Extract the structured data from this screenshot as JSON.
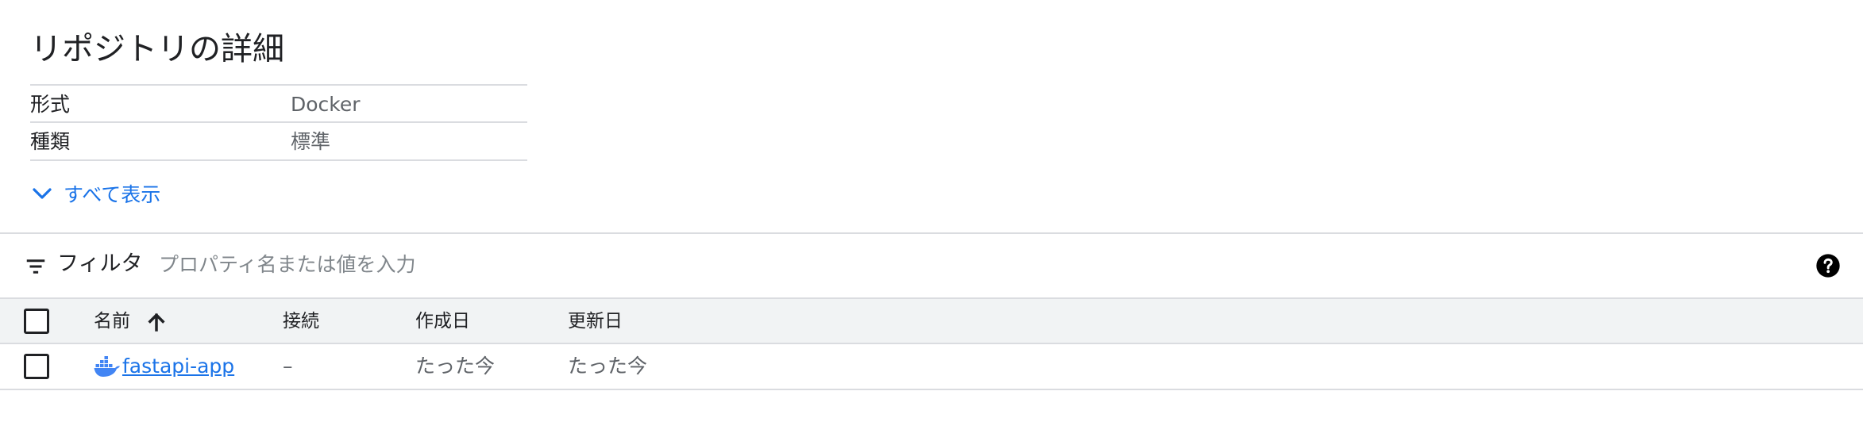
{
  "details": {
    "title": "リポジトリの詳細",
    "rows": [
      {
        "key": "形式",
        "value": "Docker"
      },
      {
        "key": "種類",
        "value": "標準"
      }
    ],
    "show_all_label": "すべて表示"
  },
  "filter": {
    "label": "フィルタ",
    "placeholder": "プロパティ名または値を入力",
    "value": ""
  },
  "table": {
    "columns": {
      "name": "名前",
      "connection": "接続",
      "created": "作成日",
      "updated": "更新日"
    },
    "sort": {
      "column": "name",
      "direction": "ascending",
      "icon": "arrow-up-icon"
    },
    "rows": [
      {
        "icon": "docker-icon",
        "name": "fastapi-app",
        "connection": "–",
        "created": "たった今",
        "updated": "たった今",
        "selected": false
      }
    ]
  },
  "colors": {
    "link": "#1a73e8",
    "docker_icon": "#4285f4",
    "header_bg": "#f1f3f4",
    "divider": "#dadce0"
  }
}
